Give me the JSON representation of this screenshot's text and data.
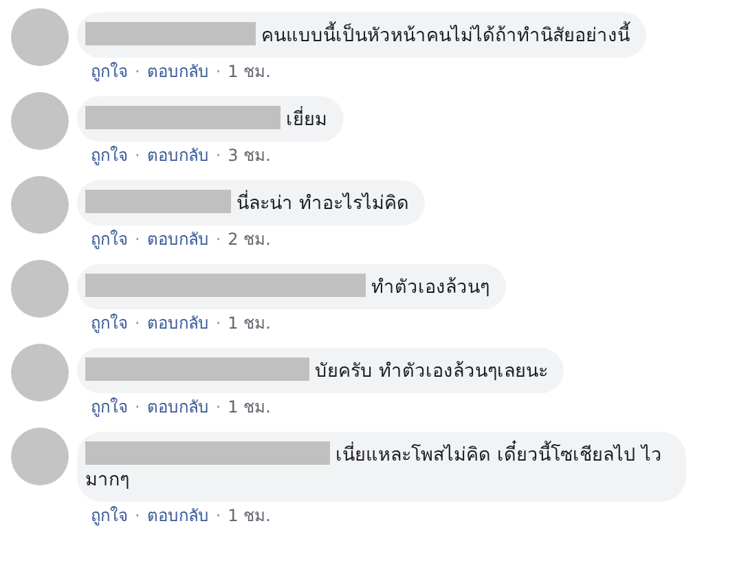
{
  "comments": [
    {
      "text": "คนแบบนี้เป็นหัวหน้าคนไม่ได้ถ้าทำนิสัยอย่างนี้",
      "meta": [
        {
          "kind": "link",
          "text": "ถูกใจ"
        },
        {
          "kind": "sep",
          "text": "·"
        },
        {
          "kind": "link",
          "text": "ตอบกลับ"
        },
        {
          "kind": "sep",
          "text": "·"
        },
        {
          "kind": "time",
          "text": "1 ชม."
        }
      ]
    },
    {
      "text": "เยี่ยม",
      "meta": [
        {
          "kind": "link",
          "text": "ถูกใจ"
        },
        {
          "kind": "sep",
          "text": "·"
        },
        {
          "kind": "link",
          "text": "ตอบกลับ"
        },
        {
          "kind": "sep",
          "text": "·"
        },
        {
          "kind": "time",
          "text": "3 ชม."
        }
      ]
    },
    {
      "text": "นี่ละน่า ทำอะไรไม่คิด",
      "meta": [
        {
          "kind": "link",
          "text": "ถูกใจ"
        },
        {
          "kind": "sep",
          "text": "·"
        },
        {
          "kind": "link",
          "text": "ตอบกลับ"
        },
        {
          "kind": "sep",
          "text": "·"
        },
        {
          "kind": "time",
          "text": "2 ชม."
        }
      ]
    },
    {
      "text": "ทำตัวเองล้วนๆ",
      "meta": [
        {
          "kind": "link",
          "text": "ถูกใจ"
        },
        {
          "kind": "sep",
          "text": "·"
        },
        {
          "kind": "link",
          "text": "ตอบกลับ"
        },
        {
          "kind": "sep",
          "text": "·"
        },
        {
          "kind": "time",
          "text": "1 ชม."
        }
      ]
    },
    {
      "text": "บัยครับ ทำตัวเองล้วนๆเลยนะ",
      "meta": [
        {
          "kind": "link",
          "text": "ถูกใจ"
        },
        {
          "kind": "sep",
          "text": "·"
        },
        {
          "kind": "link",
          "text": "ตอบกลับ"
        },
        {
          "kind": "sep",
          "text": "·"
        },
        {
          "kind": "time",
          "text": "1 ชม."
        }
      ]
    },
    {
      "text": "เนี่ยแหละโพสไม่คิด เดี๋ยวนี้โซเชียลไป ไวมากๆ",
      "meta": [
        {
          "kind": "link",
          "text": "ถูกใจ"
        },
        {
          "kind": "sep",
          "text": "·"
        },
        {
          "kind": "link",
          "text": "ตอบกลับ"
        },
        {
          "kind": "sep",
          "text": "·"
        },
        {
          "kind": "time",
          "text": "1 ชม."
        }
      ]
    }
  ]
}
